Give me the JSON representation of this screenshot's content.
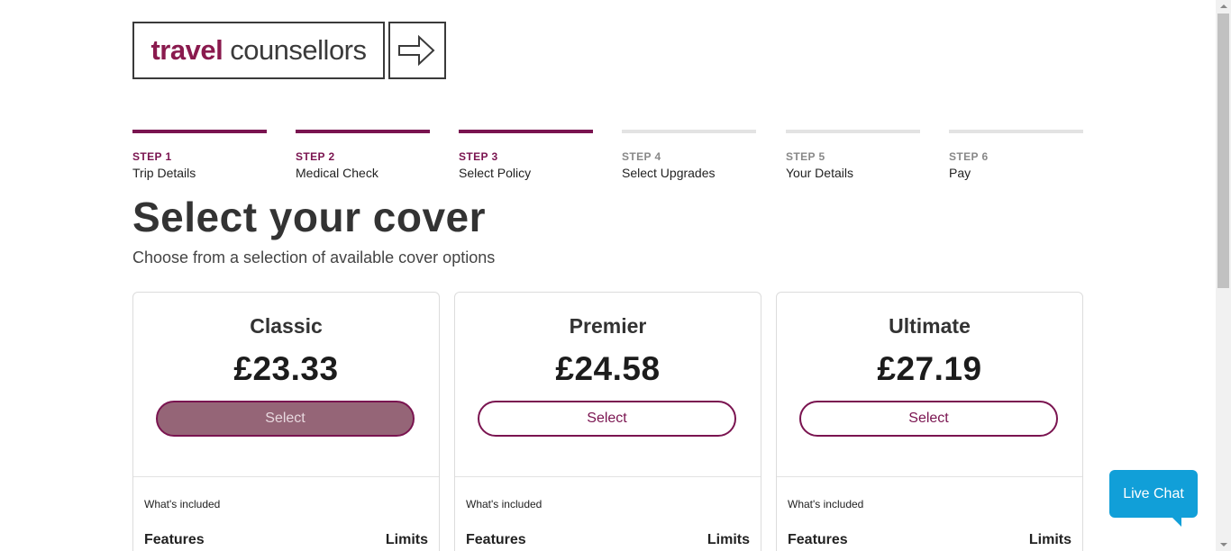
{
  "logo": {
    "brand_part1": "travel",
    "brand_part2": "counsellors",
    "arrow_icon": "arrow-right-icon"
  },
  "steps": [
    {
      "number": "STEP 1",
      "label": "Trip Details",
      "status": "complete"
    },
    {
      "number": "STEP 2",
      "label": "Medical Check",
      "status": "complete"
    },
    {
      "number": "STEP 3",
      "label": "Select Policy",
      "status": "current"
    },
    {
      "number": "STEP 4",
      "label": "Select Upgrades",
      "status": "upcoming"
    },
    {
      "number": "STEP 5",
      "label": "Your Details",
      "status": "upcoming"
    },
    {
      "number": "STEP 6",
      "label": "Pay",
      "status": "upcoming"
    }
  ],
  "heading": {
    "title": "Select your cover",
    "subtitle": "Choose from a selection of available cover options"
  },
  "plans": [
    {
      "name": "Classic",
      "price": "£23.33",
      "select_label": "Select",
      "selected": true,
      "included_label": "What's included",
      "features_header": "Features",
      "limits_header": "Limits"
    },
    {
      "name": "Premier",
      "price": "£24.58",
      "select_label": "Select",
      "selected": false,
      "included_label": "What's included",
      "features_header": "Features",
      "limits_header": "Limits"
    },
    {
      "name": "Ultimate",
      "price": "£27.19",
      "select_label": "Select",
      "selected": false,
      "included_label": "What's included",
      "features_header": "Features",
      "limits_header": "Limits"
    }
  ],
  "live_chat": {
    "label": "Live Chat"
  },
  "colors": {
    "brand": "#7a1450",
    "selected_button": "#956577",
    "step_inactive": "#e3e3e3",
    "live_chat": "#119fd8"
  }
}
